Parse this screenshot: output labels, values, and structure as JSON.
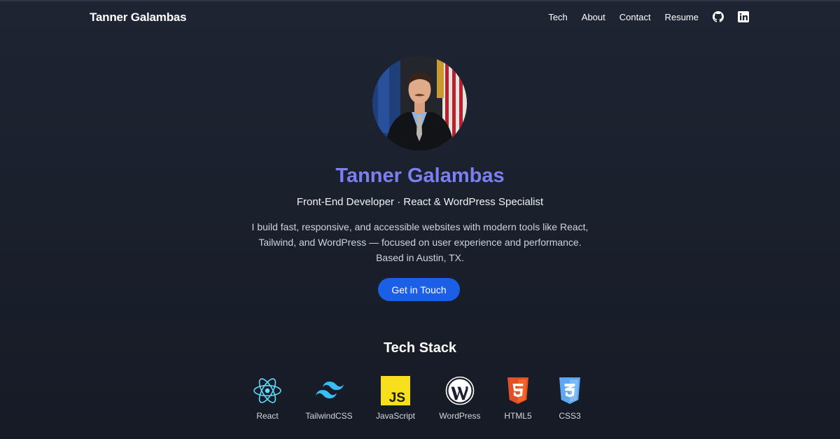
{
  "nav": {
    "brand": "Tanner Galambas",
    "links": [
      "Tech",
      "About",
      "Contact",
      "Resume"
    ],
    "icons": [
      "github-icon",
      "linkedin-icon"
    ]
  },
  "hero": {
    "name": "Tanner Galambas",
    "tagline": "Front-End Developer · React & WordPress Specialist",
    "description": "I build fast, responsive, and accessible websites with modern tools like React, Tailwind, and WordPress — focused on user experience and performance. Based in Austin, TX.",
    "cta": "Get in Touch"
  },
  "stack": {
    "title": "Tech Stack",
    "items": [
      {
        "label": "React",
        "icon": "react-icon",
        "color": "#61dafb"
      },
      {
        "label": "TailwindCSS",
        "icon": "tailwind-icon",
        "color": "#38bdf8"
      },
      {
        "label": "JavaScript",
        "icon": "javascript-icon",
        "color": "#f7df1e"
      },
      {
        "label": "WordPress",
        "icon": "wordpress-icon",
        "color": "#ffffff"
      },
      {
        "label": "HTML5",
        "icon": "html5-icon",
        "color": "#e34f26"
      },
      {
        "label": "CSS3",
        "icon": "css3-icon",
        "color": "#5da8f0"
      }
    ]
  },
  "colors": {
    "background": "#1a202c",
    "accent_name": "#7b7ff0",
    "button": "#1b5fe6"
  }
}
